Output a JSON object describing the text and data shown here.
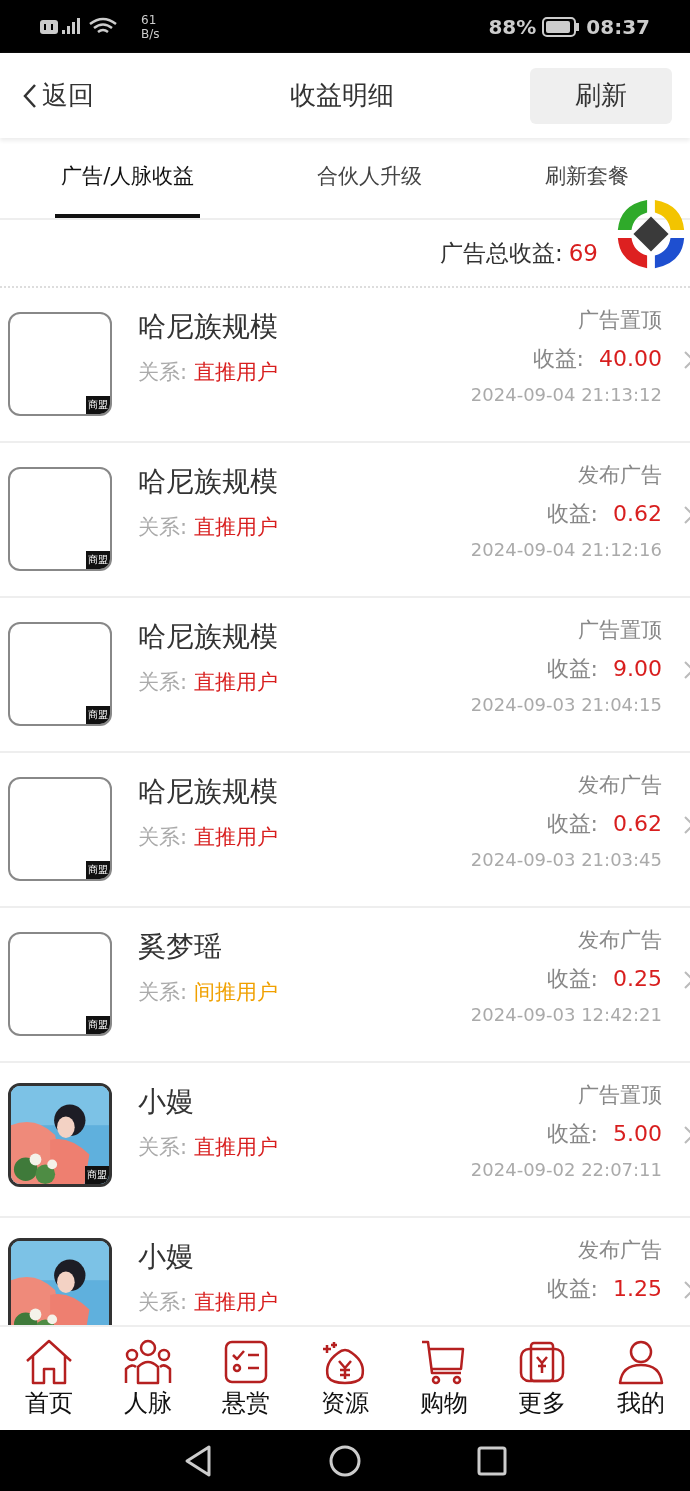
{
  "status_bar": {
    "net_speed": [
      "61",
      "B/s"
    ],
    "battery": "88%",
    "time": "08:37"
  },
  "header": {
    "back": "返回",
    "title": "收益明细",
    "refresh": "刷新"
  },
  "tabs": [
    {
      "label": "广告/人脉收益",
      "selected": true
    },
    {
      "label": "合伙人升级",
      "selected": false
    },
    {
      "label": "刷新套餐",
      "selected": false
    }
  ],
  "total": {
    "label": "广告总收益:",
    "value": "69"
  },
  "records": [
    {
      "kind": "blank",
      "badge": "商盟",
      "name": "哈尼族规模",
      "relation_label": "关系:",
      "relation": "直推用户",
      "color": "#d81e1e",
      "type": "广告置顶",
      "income_label": "收益:",
      "income": "40.00",
      "time": "2024-09-04 21:13:12"
    },
    {
      "kind": "blank",
      "badge": "商盟",
      "name": "哈尼族规模",
      "relation_label": "关系:",
      "relation": "直推用户",
      "color": "#d81e1e",
      "type": "发布广告",
      "income_label": "收益:",
      "income": "0.62",
      "time": "2024-09-04 21:12:16"
    },
    {
      "kind": "blank",
      "badge": "商盟",
      "name": "哈尼族规模",
      "relation_label": "关系:",
      "relation": "直推用户",
      "color": "#d81e1e",
      "type": "广告置顶",
      "income_label": "收益:",
      "income": "9.00",
      "time": "2024-09-03 21:04:15"
    },
    {
      "kind": "blank",
      "badge": "商盟",
      "name": "哈尼族规模",
      "relation_label": "关系:",
      "relation": "直推用户",
      "color": "#d81e1e",
      "type": "发布广告",
      "income_label": "收益:",
      "income": "0.62",
      "time": "2024-09-03 21:03:45"
    },
    {
      "kind": "blank",
      "badge": "商盟",
      "name": "奚梦瑶",
      "relation_label": "关系:",
      "relation": "间推用户",
      "color": "#f0a000",
      "type": "发布广告",
      "income_label": "收益:",
      "income": "0.25",
      "time": "2024-09-03 12:42:21"
    },
    {
      "kind": "picture",
      "badge": "商盟",
      "name": "小嫚",
      "relation_label": "关系:",
      "relation": "直推用户",
      "color": "#d81e1e",
      "type": "广告置顶",
      "income_label": "收益:",
      "income": "5.00",
      "time": "2024-09-02 22:07:11"
    },
    {
      "kind": "picture",
      "name": "小嫚",
      "relation_label": "关系:",
      "relation": "直推用户",
      "color": "#d81e1e",
      "type": "发布广告",
      "income_label": "收益:",
      "income": "1.25"
    }
  ],
  "bottom_nav": [
    {
      "label": "首页",
      "kind": "home"
    },
    {
      "label": "人脉",
      "kind": "people"
    },
    {
      "label": "悬赏",
      "kind": "tasks"
    },
    {
      "label": "资源",
      "kind": "moneybag"
    },
    {
      "label": "购物",
      "kind": "cart"
    },
    {
      "label": "更多",
      "kind": "wallet"
    },
    {
      "label": "我的",
      "kind": "user"
    }
  ]
}
